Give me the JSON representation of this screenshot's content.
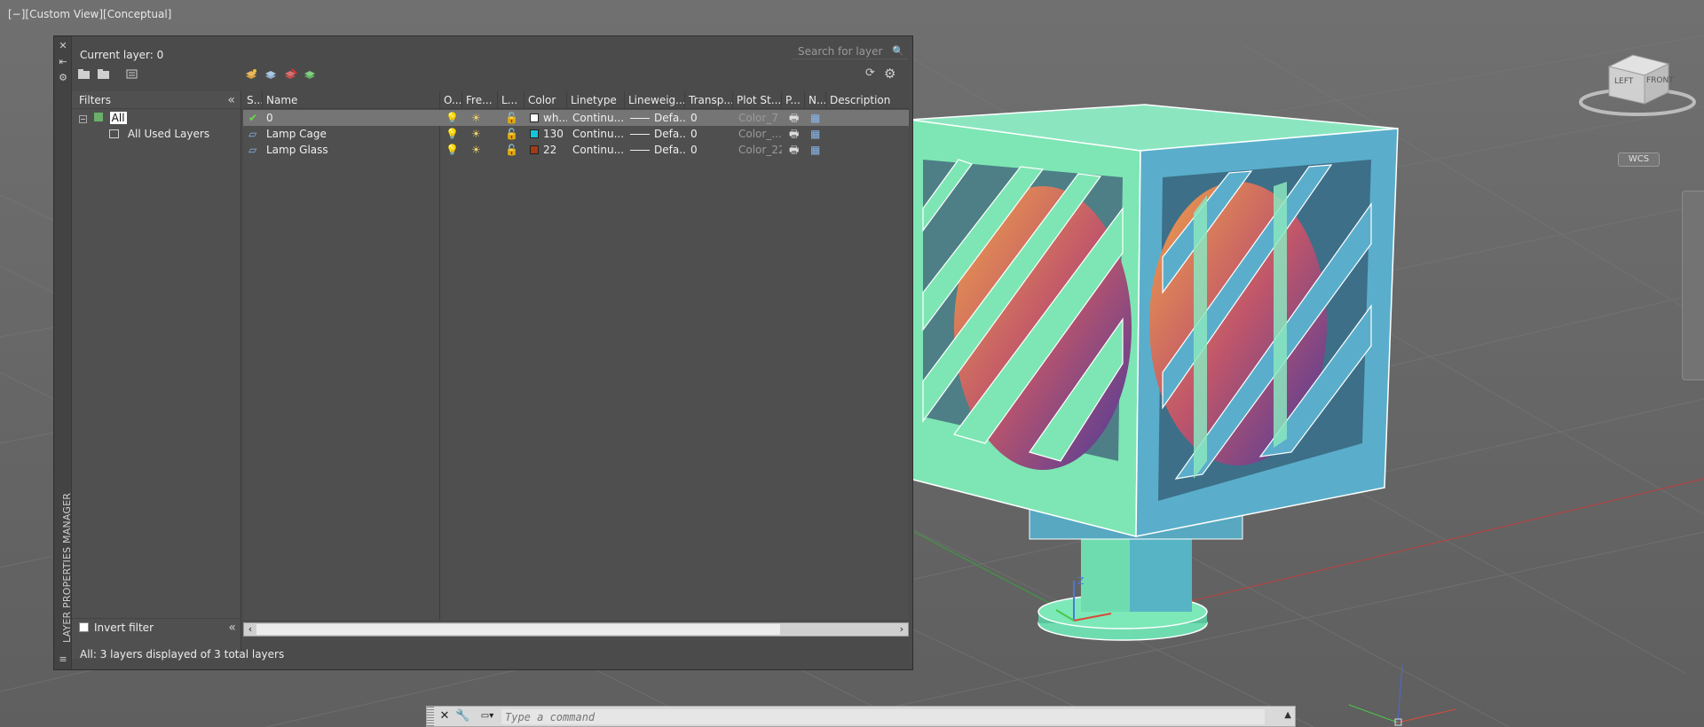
{
  "viewport": {
    "label": "[−][Custom View][Conceptual]",
    "viewcube": {
      "left": "LEFT",
      "front": "FRONT",
      "wcs": "WCS"
    },
    "ucs": {
      "z": "Z"
    }
  },
  "palette": {
    "title": "LAYER PROPERTIES MANAGER",
    "current_layer": "Current layer: 0",
    "search_placeholder": "Search for layer",
    "filters_label": "Filters",
    "tree": {
      "all": "All",
      "all_used": "All Used Layers"
    },
    "invert_filter": "Invert filter",
    "status": "All: 3 layers displayed of 3 total layers",
    "columns": [
      "S...",
      "Name",
      "O...",
      "Fre...",
      "L...",
      "Color",
      "Linetype",
      "Lineweig...",
      "Transp...",
      "Plot St...",
      "P...",
      "N...",
      "Description"
    ],
    "layers": [
      {
        "name": "0",
        "color_name": "wh...",
        "color_hex": "#ffffff",
        "linetype": "Continu...",
        "lineweight": "Defa...",
        "transparency": "0",
        "plot_style": "Color_7",
        "selected": true,
        "current": true
      },
      {
        "name": "Lamp Cage",
        "color_name": "130",
        "color_hex": "#14c4d8",
        "linetype": "Continu...",
        "lineweight": "Defa...",
        "transparency": "0",
        "plot_style": "Color_...",
        "selected": false,
        "current": false
      },
      {
        "name": "Lamp Glass",
        "color_name": "22",
        "color_hex": "#a33b16",
        "linetype": "Continu...",
        "lineweight": "Defa...",
        "transparency": "0",
        "plot_style": "Color_22",
        "selected": false,
        "current": false
      }
    ]
  },
  "command_line": {
    "placeholder": "Type a command"
  }
}
